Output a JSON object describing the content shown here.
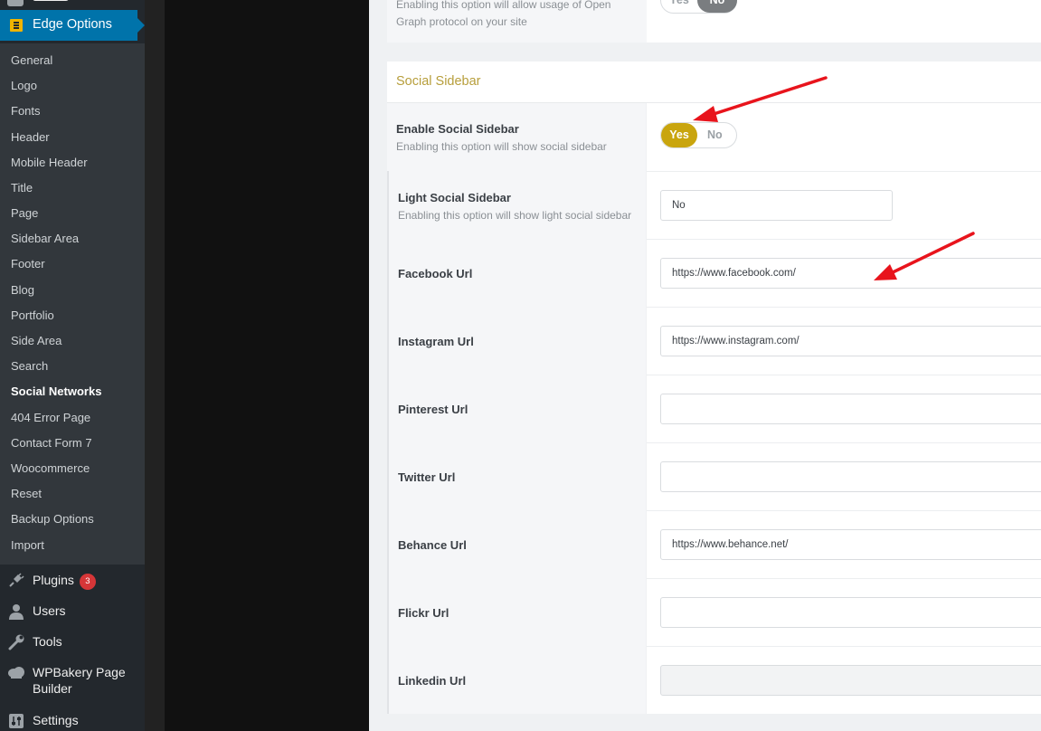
{
  "sidebar": {
    "edge_options_label": "Edge Options",
    "submenu": [
      "General",
      "Logo",
      "Fonts",
      "Header",
      "Mobile Header",
      "Title",
      "Page",
      "Sidebar Area",
      "Footer",
      "Blog",
      "Portfolio",
      "Side Area",
      "Search",
      "Social Networks",
      "404 Error Page",
      "Contact Form 7",
      "Woocommerce",
      "Reset",
      "Backup Options",
      "Import"
    ],
    "active_submenu": "Social Networks",
    "plugins_label": "Plugins",
    "plugins_badge": "3",
    "users_label": "Users",
    "tools_label": "Tools",
    "wpbakery_label_line1": "WPBakery Page",
    "wpbakery_label_line2": "Builder",
    "settings_label": "Settings"
  },
  "open_graph": {
    "desc_line1": "Enabling this option will allow usage of Open",
    "desc_line2": "Graph protocol on your site",
    "yes_label": "Yes",
    "no_label": "No",
    "value": "No"
  },
  "section": {
    "title": "Social Sidebar"
  },
  "enable_social_sidebar": {
    "title": "Enable Social Sidebar",
    "desc": "Enabling this option will show social sidebar",
    "yes_label": "Yes",
    "no_label": "No",
    "value": "Yes"
  },
  "light_social_sidebar": {
    "title": "Light Social Sidebar",
    "desc": "Enabling this option will show light social sidebar",
    "value": "No"
  },
  "urls": {
    "facebook": {
      "label": "Facebook Url",
      "value": "https://www.facebook.com/"
    },
    "instagram": {
      "label": "Instagram Url",
      "value": "https://www.instagram.com/"
    },
    "pinterest": {
      "label": "Pinterest Url",
      "value": ""
    },
    "twitter": {
      "label": "Twitter Url",
      "value": ""
    },
    "behance": {
      "label": "Behance Url",
      "value": "https://www.behance.net/"
    },
    "flickr": {
      "label": "Flickr Url",
      "value": ""
    },
    "linkedin": {
      "label": "Linkedin Url",
      "value": ""
    }
  },
  "colors": {
    "accent_yes": "#c9a50e",
    "section_title": "#b79e3b",
    "wp_blue": "#0073aa",
    "annotation_arrow": "#e8141c"
  }
}
